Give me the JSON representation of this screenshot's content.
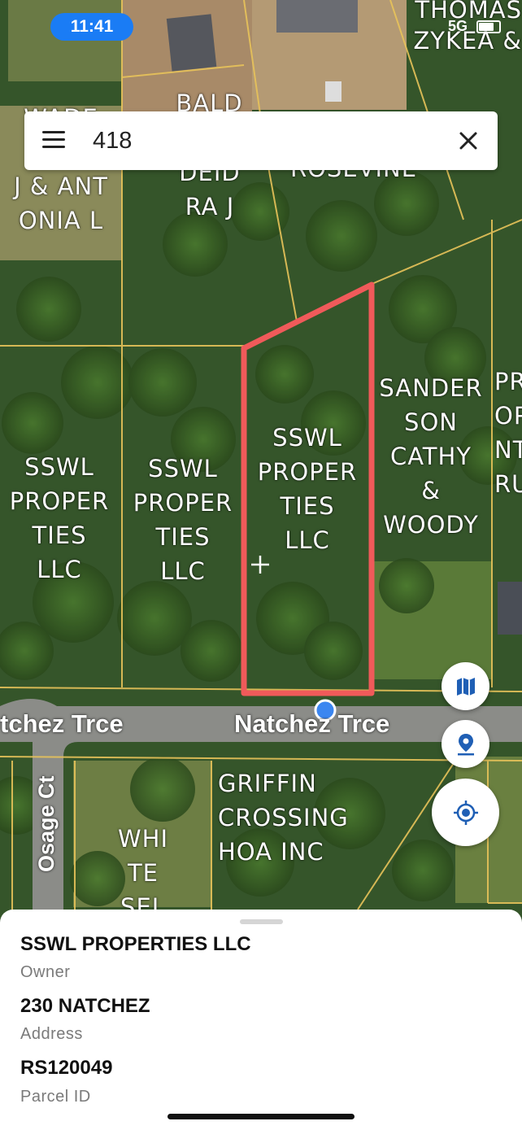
{
  "status_bar": {
    "time": "11:41",
    "network": "5G"
  },
  "search": {
    "query": "418"
  },
  "map": {
    "parcel_labels": [
      {
        "id": "thomas",
        "text": "THOMAS\nZYKEA &"
      },
      {
        "id": "wade",
        "text": "WADE\nB\nJ & ANT\nONIA L"
      },
      {
        "id": "bald",
        "text": "BALD"
      },
      {
        "id": "deidra",
        "text": "DEID\nRA J"
      },
      {
        "id": "roseville",
        "text": "ROSEVINE"
      },
      {
        "id": "sswl-left",
        "text": "SSWL\nPROPER\nTIES\nLLC"
      },
      {
        "id": "sswl-middle",
        "text": "SSWL\nPROPER\nTIES\nLLC"
      },
      {
        "id": "sswl-selected",
        "text": "SSWL\nPROPER\nTIES\nLLC"
      },
      {
        "id": "sanderson",
        "text": "SANDER\nSON\nCATHY\n&\nWOODY"
      },
      {
        "id": "pr-right",
        "text": "PR\nOP\nNT\nRU"
      },
      {
        "id": "griffin",
        "text": "GRIFFIN\nCROSSING\nHOA INC"
      },
      {
        "id": "white",
        "text": "WHI\nTE\nSEL"
      }
    ],
    "roads": [
      {
        "id": "natchez-left",
        "text": "tchez Trce"
      },
      {
        "id": "natchez-main",
        "text": "Natchez Trce"
      },
      {
        "id": "osage",
        "text": "Osage Ct"
      }
    ],
    "colors": {
      "parcel_line": "#e8c35a",
      "selection": "#f05a5a",
      "location": "#3b86f0",
      "fab_icon": "#1f5fb5"
    }
  },
  "controls": {
    "map_layers": "map-icon",
    "place_pin": "pin-icon",
    "my_location": "crosshair-icon"
  },
  "parcel": {
    "owner": "SSWL PROPERTIES LLC",
    "owner_label": "Owner",
    "address": "230 NATCHEZ",
    "address_label": "Address",
    "parcel_id": "RS120049",
    "parcel_id_label": "Parcel ID"
  }
}
